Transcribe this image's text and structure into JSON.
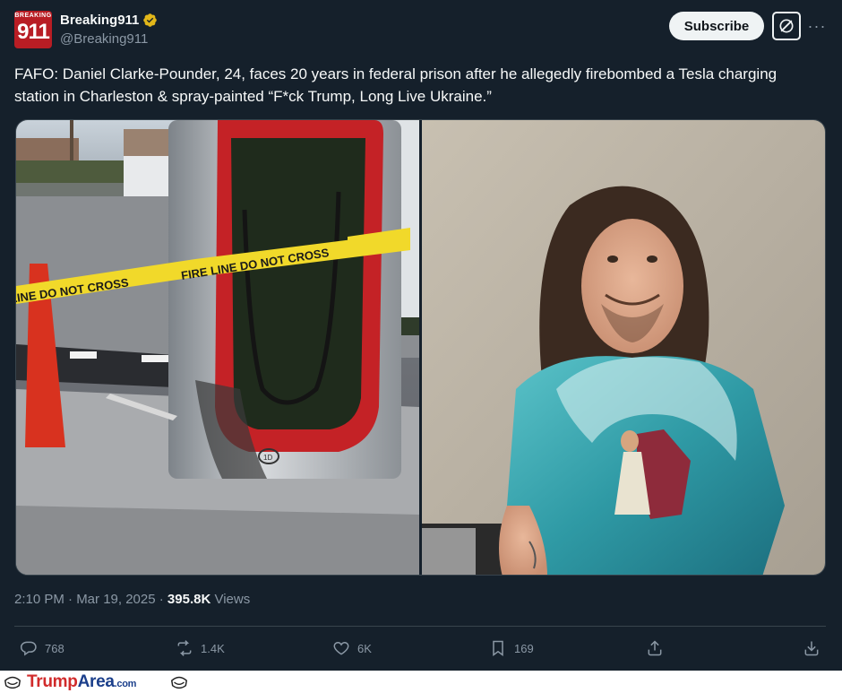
{
  "author": {
    "avatar_top": "BREAKING",
    "avatar_num": "911",
    "display_name": "Breaking911",
    "handle": "@Breaking911"
  },
  "header": {
    "subscribe_label": "Subscribe",
    "more_label": "···"
  },
  "tweet": {
    "text": "FAFO: Daniel Clarke-Pounder, 24, faces 20 years in federal prison after he allegedly firebombed a Tesla charging station in Charleston & spray-painted “F*ck Trump, Long Live Ukraine.”",
    "time": "2:10 PM · Mar 19, 2025 · ",
    "views_count": "395.8K",
    "views_label": " Views"
  },
  "media": {
    "tape_text_1": "FIRE LINE DO NOT CROSS",
    "tape_text_2": "FIRE LINE DO NOT CROSS",
    "tape_text_3": "FIRE LINE DO NOT CROSS",
    "stall_label": "1D"
  },
  "actions": {
    "replies": "768",
    "reposts": "1.4K",
    "likes": "6K",
    "bookmarks": "169"
  },
  "watermark": {
    "trump": "Trump",
    "area": "Area",
    "com": ".com"
  },
  "colors": {
    "background": "#15202b",
    "text_primary": "#f7f9f9",
    "text_secondary": "#8b98a5",
    "divider": "#38444d",
    "verified_gold": "#e2b719",
    "brand_red": "#b81d24"
  },
  "icons": [
    "verified-badge-icon",
    "grok-icon",
    "more-icon",
    "reply-icon",
    "repost-icon",
    "like-icon",
    "bookmark-icon",
    "share-icon",
    "download-icon",
    "helmet-icon"
  ]
}
